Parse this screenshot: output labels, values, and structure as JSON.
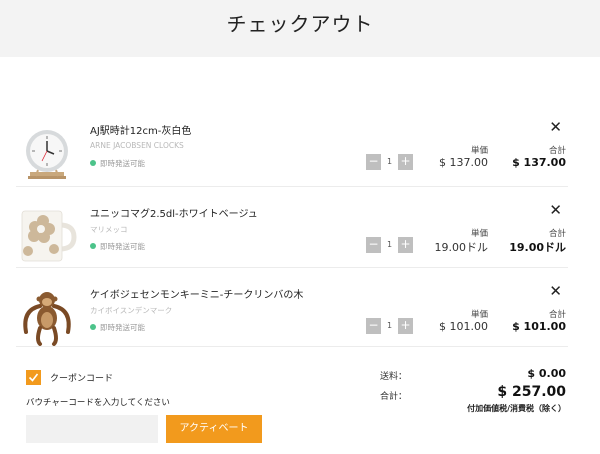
{
  "header": {
    "title": "チェックアウト"
  },
  "labels": {
    "unit_price": "単価",
    "subtotal": "合計"
  },
  "items": [
    {
      "name": "AJ駅時計12cm-灰白色",
      "brand": "ARNE JACOBSEN CLOCKS",
      "stock": "即時発送可能",
      "qty": "1",
      "unit_price": "$ 137.00",
      "subtotal": "$ 137.00",
      "icon": "wall-clock"
    },
    {
      "name": "ユニッコマグ2.5dl-ホワイトベージュ",
      "brand": "マリメッコ",
      "stock": "即時発送可能",
      "qty": "1",
      "unit_price": "19.00ドル",
      "subtotal": "19.00ドル",
      "icon": "mug"
    },
    {
      "name": "ケイボジェセンモンキーミニ-チークリンバの木",
      "brand": "カイボイスンデンマーク",
      "stock": "即時発送可能",
      "qty": "1",
      "unit_price": "$ 101.00",
      "subtotal": "$ 101.00",
      "icon": "wooden-monkey"
    }
  ],
  "coupon": {
    "label": "クーポンコード",
    "checked": true,
    "voucher_label": "バウチャーコードを入力してください",
    "voucher_value": "",
    "activate_label": "アクティベート"
  },
  "summary": {
    "shipping_label": "送料：",
    "shipping_value": "$ 0.00",
    "total_label": "合計：",
    "total_value": "$ 257.00",
    "tax_note": "付加価値税/消費税（除く）"
  },
  "colors": {
    "accent": "#f29a1d",
    "stock_dot": "#4cc38a",
    "header_bg": "#f3f3f3"
  }
}
